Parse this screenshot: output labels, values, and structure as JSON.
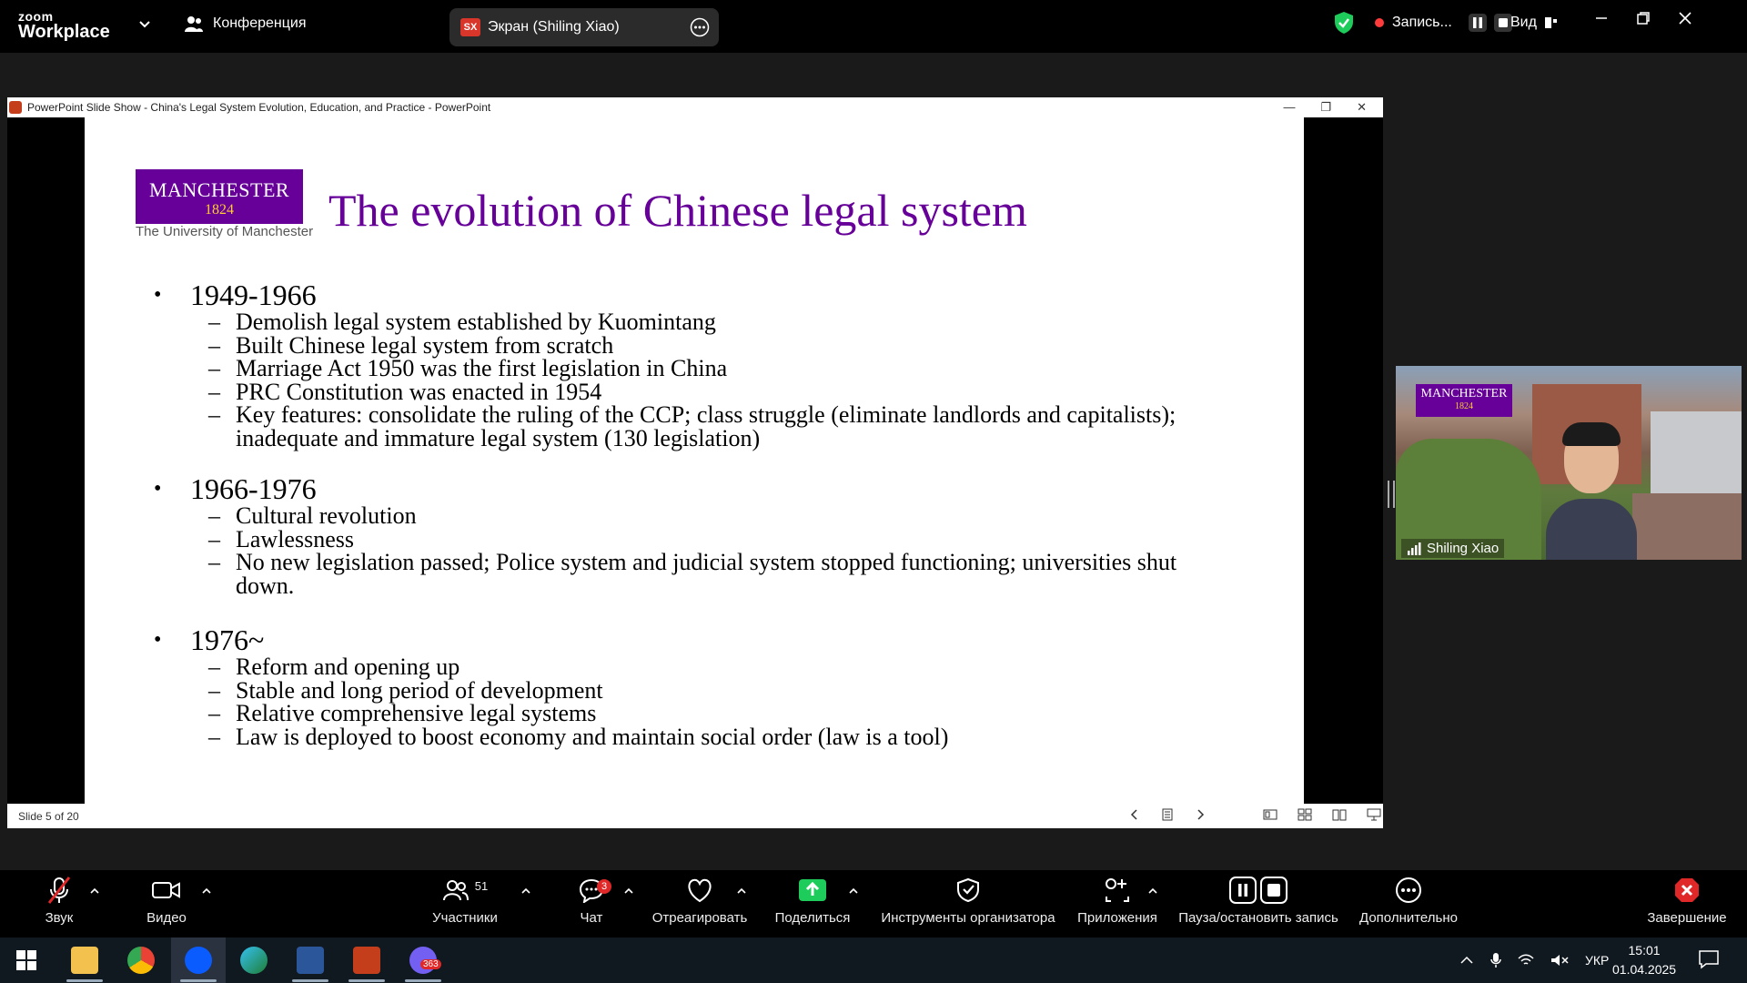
{
  "app": {
    "logo_top": "zoom",
    "logo_bottom": "Workplace",
    "conference_label": "Конференция",
    "share_pill": {
      "initials": "SX",
      "label": "Экран (Shiling Xiao)"
    },
    "recording_label": "Запись...",
    "view_label": "Вид"
  },
  "ppt": {
    "window_title": "PowerPoint Slide Show  -  China's Legal System Evolution, Education, and Practice - PowerPoint",
    "status": "Slide 5 of 20"
  },
  "slide": {
    "logo_name": "MANCHESTER",
    "logo_year": "1824",
    "logo_subtitle": "The University of Manchester",
    "title": "The evolution of Chinese legal system",
    "sections": [
      {
        "heading": "1949-1966",
        "items": [
          "Demolish legal system established by Kuomintang",
          "Built Chinese legal system from scratch",
          "Marriage Act 1950 was the first legislation in China",
          "PRC Constitution was enacted in 1954",
          "Key features: consolidate the ruling of the CCP; class struggle (eliminate landlords and capitalists); inadequate and immature legal system (130 legislation)"
        ]
      },
      {
        "heading": "1966-1976",
        "items": [
          "Cultural revolution",
          "Lawlessness",
          "No new legislation passed; Police system and judicial system stopped functioning; universities shut down."
        ]
      },
      {
        "heading": "1976~",
        "items": [
          "Reform and opening up",
          "Stable and long period of development",
          "Relative comprehensive legal systems",
          "Law is deployed to boost economy and maintain social order (law is a tool)"
        ]
      }
    ]
  },
  "video": {
    "participant_name": "Shiling Xiao",
    "logo_name": "MANCHESTER",
    "logo_year": "1824"
  },
  "toolbar": {
    "audio": "Звук",
    "video": "Видео",
    "participants": "Участники",
    "participants_count": "51",
    "chat": "Чат",
    "chat_badge": "3",
    "react": "Отреагировать",
    "share": "Поделиться",
    "host_tools": "Инструменты организатора",
    "apps": "Приложения",
    "pause_record": "Пауза/остановить запись",
    "more": "Дополнительно",
    "end": "Завершение"
  },
  "taskbar": {
    "viber_badge": "363",
    "language": "УКР",
    "time": "15:01",
    "date": "01.04.2025"
  },
  "colors": {
    "accent_purple": "#660099",
    "manchester_gold": "#ffcc33",
    "share_green": "#1dcc5a",
    "end_red": "#e02828"
  }
}
